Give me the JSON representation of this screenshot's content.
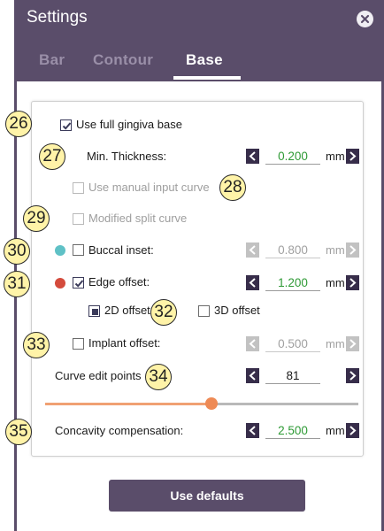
{
  "header": {
    "title": "Settings",
    "close_icon": "close-icon"
  },
  "tabs": [
    {
      "label": "Bar",
      "active": false
    },
    {
      "label": "Contour",
      "active": false
    },
    {
      "label": "Base",
      "active": true
    }
  ],
  "settings": {
    "use_full_gingiva_base": {
      "label": "Use full gingiva base",
      "checked": true
    },
    "min_thickness": {
      "label": "Min. Thickness:",
      "value": "0.200",
      "unit": "mm"
    },
    "use_manual_input_curve": {
      "label": "Use manual input curve",
      "checked": false,
      "disabled": true
    },
    "modified_split_curve": {
      "label": "Modified split curve",
      "checked": false,
      "disabled": true
    },
    "buccal_inset": {
      "label": "Buccal inset:",
      "checked": false,
      "value": "0.800",
      "unit": "mm",
      "dot_color": "#5fc1c6"
    },
    "edge_offset": {
      "label": "Edge offset:",
      "checked": true,
      "value": "1.200",
      "unit": "mm",
      "dot_color": "#d44b3c"
    },
    "offset_mode": {
      "option_2d": "2D offset",
      "option_3d": "3D offset",
      "selected": "2D offset"
    },
    "implant_offset": {
      "label": "Implant offset:",
      "checked": false,
      "value": "0.500",
      "unit": "mm"
    },
    "curve_edit_points": {
      "label": "Curve edit points",
      "value": "81",
      "slider_fraction": 0.53
    },
    "concavity_compensation": {
      "label": "Concavity compensation:",
      "value": "2.500",
      "unit": "mm"
    }
  },
  "callouts": [
    "26",
    "27",
    "28",
    "29",
    "30",
    "31",
    "32",
    "33",
    "34",
    "35"
  ],
  "footer": {
    "use_defaults_label": "Use defaults"
  },
  "colors": {
    "panel": "#5a4d6a",
    "accent_green": "#2e9a35",
    "slider": "#ee8a55",
    "callout_fill": "#fff3a8"
  }
}
